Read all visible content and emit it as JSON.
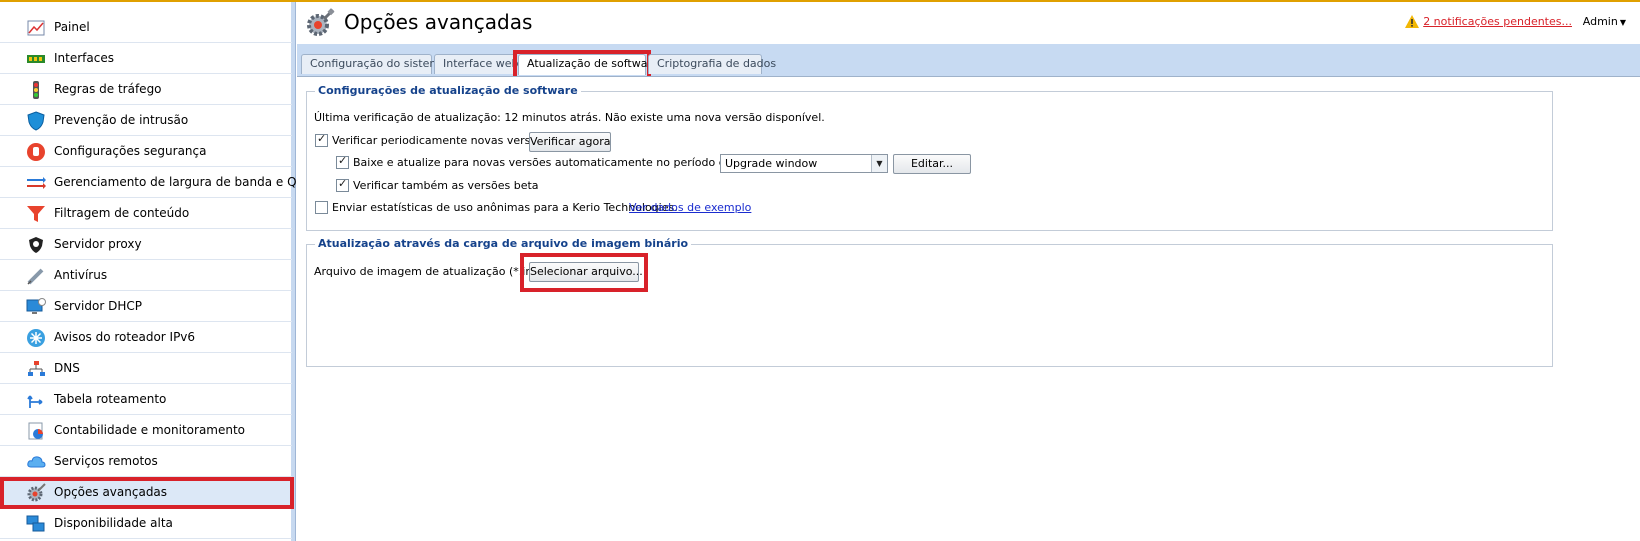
{
  "sidebar": {
    "items": [
      {
        "label": "Painel",
        "icon": "dashboard-icon"
      },
      {
        "label": "Interfaces",
        "icon": "network-card-icon"
      },
      {
        "label": "Regras de tráfego",
        "icon": "traffic-light-icon"
      },
      {
        "label": "Prevenção de intrusão",
        "icon": "shield-icon"
      },
      {
        "label": "Configurações segurança",
        "icon": "stop-hand-icon"
      },
      {
        "label": "Gerenciamento de largura de banda e QoS",
        "icon": "bandwidth-icon"
      },
      {
        "label": "Filtragem de conteúdo",
        "icon": "funnel-icon"
      },
      {
        "label": "Servidor proxy",
        "icon": "proxy-icon"
      },
      {
        "label": "Antivírus",
        "icon": "syringe-icon"
      },
      {
        "label": "Servidor DHCP",
        "icon": "monitor-icon"
      },
      {
        "label": "Avisos do roteador IPv6",
        "icon": "ipv6-icon"
      },
      {
        "label": "DNS",
        "icon": "dns-tree-icon"
      },
      {
        "label": "Tabela roteamento",
        "icon": "routing-icon"
      },
      {
        "label": "Contabilidade e monitoramento",
        "icon": "chart-icon"
      },
      {
        "label": "Serviços remotos",
        "icon": "cloud-icon"
      },
      {
        "label": "Opções avançadas",
        "icon": "gear-icon",
        "active": true
      },
      {
        "label": "Disponibilidade alta",
        "icon": "ha-monitors-icon"
      }
    ]
  },
  "header": {
    "title": "Opções avançadas",
    "notifications": "2 notificações pendentes...",
    "user": "Admin"
  },
  "tabs": [
    {
      "label": "Configuração do sistema"
    },
    {
      "label": "Interface web"
    },
    {
      "label": "Atualização de software",
      "active": true
    },
    {
      "label": "Criptografia de dados"
    }
  ],
  "software_update": {
    "legend": "Configurações de atualização de software",
    "last_check": "Última verificação de atualização: 12 minutos atrás. Não existe uma nova versão disponível.",
    "periodic_check": {
      "label": "Verificar periodicamente novas versões",
      "checked": true
    },
    "check_now_button": "Verificar agora",
    "auto_update": {
      "label": "Baixe e atualize para novas versões automaticamente no período de tempo:",
      "checked": true
    },
    "window_select_value": "Upgrade window",
    "edit_button": "Editar...",
    "beta": {
      "label": "Verificar também as versões beta",
      "checked": true
    },
    "stats": {
      "label": "Enviar estatísticas de uso anônimas para a Kerio Technologies.",
      "checked": false
    },
    "stats_link": "Ver dados de exemplo"
  },
  "binary_upload": {
    "legend": "Atualização através da carga de arquivo de imagem binário",
    "file_label": "Arquivo de imagem de atualização (*.img):",
    "select_button": "Selecionar arquivo..."
  },
  "colors": {
    "highlight": "#d8222a",
    "legend_text": "#15428b",
    "content_bg": "#c7daf2",
    "link": "#1a2ccf"
  }
}
